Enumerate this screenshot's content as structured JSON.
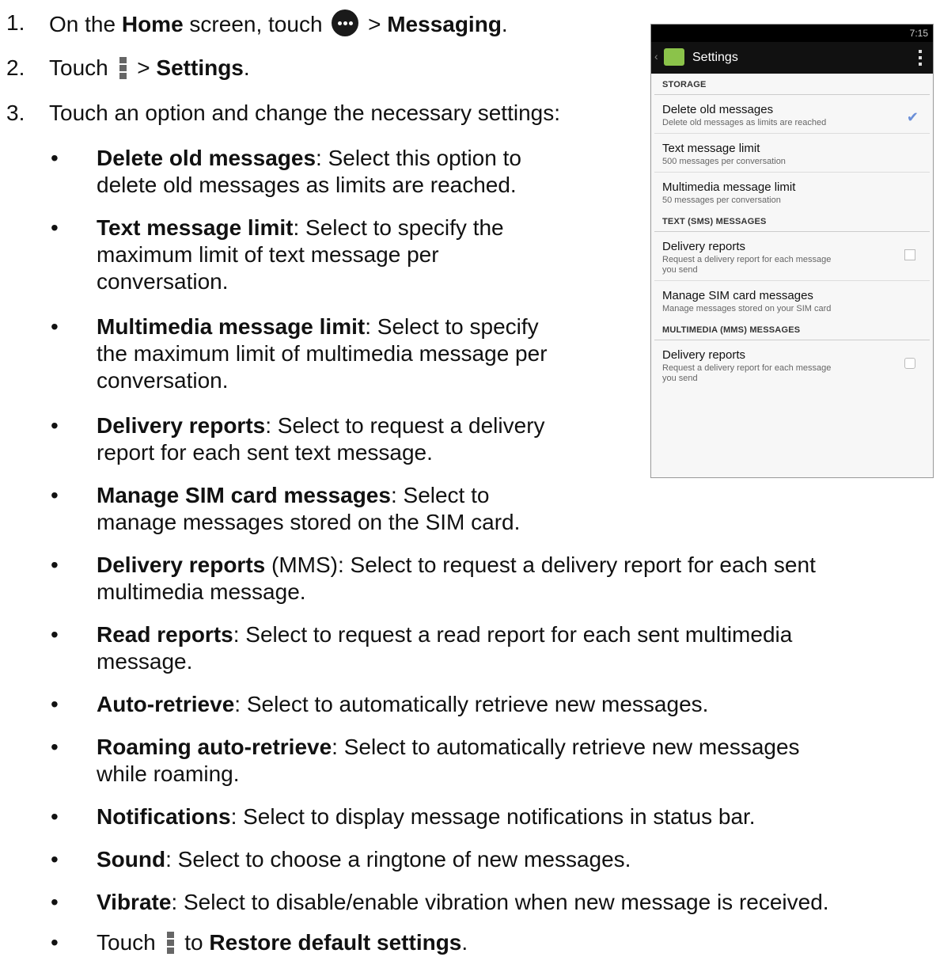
{
  "steps": [
    {
      "num": "1.",
      "pre": "On the ",
      "b1": "Home",
      "mid": " screen, touch ",
      "post": " > ",
      "b2": "Messaging",
      "end": "."
    },
    {
      "num": "2.",
      "pre": "Touch ",
      "post": " > ",
      "b2": "Settings",
      "end": "."
    },
    {
      "num": "3.",
      "text": "Touch an option and change the necessary settings:"
    }
  ],
  "bullets": [
    {
      "b": "Delete old messages",
      "l1": ": Select this option to",
      "l2": "delete old messages as limits are reached."
    },
    {
      "b": "Text message limit",
      "l1": ": Select to specify the",
      "l2": "maximum limit of text message per",
      "l3": "conversation."
    },
    {
      "b": "Multimedia message limit",
      "l1": ": Select to specify",
      "l2": "the maximum limit of multimedia message per",
      "l3": "conversation."
    },
    {
      "b": "Delivery reports",
      "l1": ": Select to request a delivery",
      "l2": "report for each sent text message."
    },
    {
      "b": "Manage SIM card messages",
      "l1": ": Select to",
      "l2": "manage messages stored on the SIM card."
    },
    {
      "b": "Delivery reports",
      "l1": " (MMS): Select to request a delivery report for each sent",
      "l2": "multimedia message."
    },
    {
      "b": "Read reports",
      "l1": ": Select to request a read report for each sent multimedia",
      "l2": "message."
    },
    {
      "b": "Auto-retrieve",
      "l1": ": Select to automatically retrieve new messages."
    },
    {
      "b": "Roaming auto-retrieve",
      "l1": ": Select to automatically retrieve new messages",
      "l2": "while roaming."
    },
    {
      "b": "Notifications",
      "l1": ": Select to display message notifications in status bar."
    },
    {
      "b": "Sound",
      "l1": ": Select to choose a ringtone of new messages."
    },
    {
      "b": "Vibrate",
      "l1": ": Select to disable/enable vibration when new message is received."
    }
  ],
  "last_bullet": {
    "pre": "Touch ",
    "mid": " to ",
    "b": "Restore default settings",
    "end": "."
  },
  "bullet_char": "•",
  "icons": {
    "apps": "apps-grid-icon",
    "menu": "overflow-menu-icon"
  },
  "phone": {
    "time": "7:15",
    "title": "Settings",
    "back": "‹",
    "sections": [
      {
        "header": "STORAGE",
        "items": [
          {
            "title": "Delete old messages",
            "sub": "Delete old messages as limits are reached",
            "control": "checked"
          },
          {
            "title": "Text message limit",
            "sub": "500 messages per conversation"
          },
          {
            "title": "Multimedia message limit",
            "sub": "50 messages per conversation"
          }
        ]
      },
      {
        "header": "TEXT (SMS) MESSAGES",
        "items": [
          {
            "title": "Delivery reports",
            "sub": "Request a delivery report for each message you send",
            "control": "unchecked"
          },
          {
            "title": "Manage SIM card messages",
            "sub": "Manage messages stored on your SIM card"
          }
        ]
      },
      {
        "header": "MULTIMEDIA (MMS) MESSAGES",
        "items": [
          {
            "title": "Delivery reports",
            "sub": "Request a delivery report for each message you send",
            "control": "unchecked"
          }
        ]
      }
    ],
    "checkmark": "✔"
  }
}
